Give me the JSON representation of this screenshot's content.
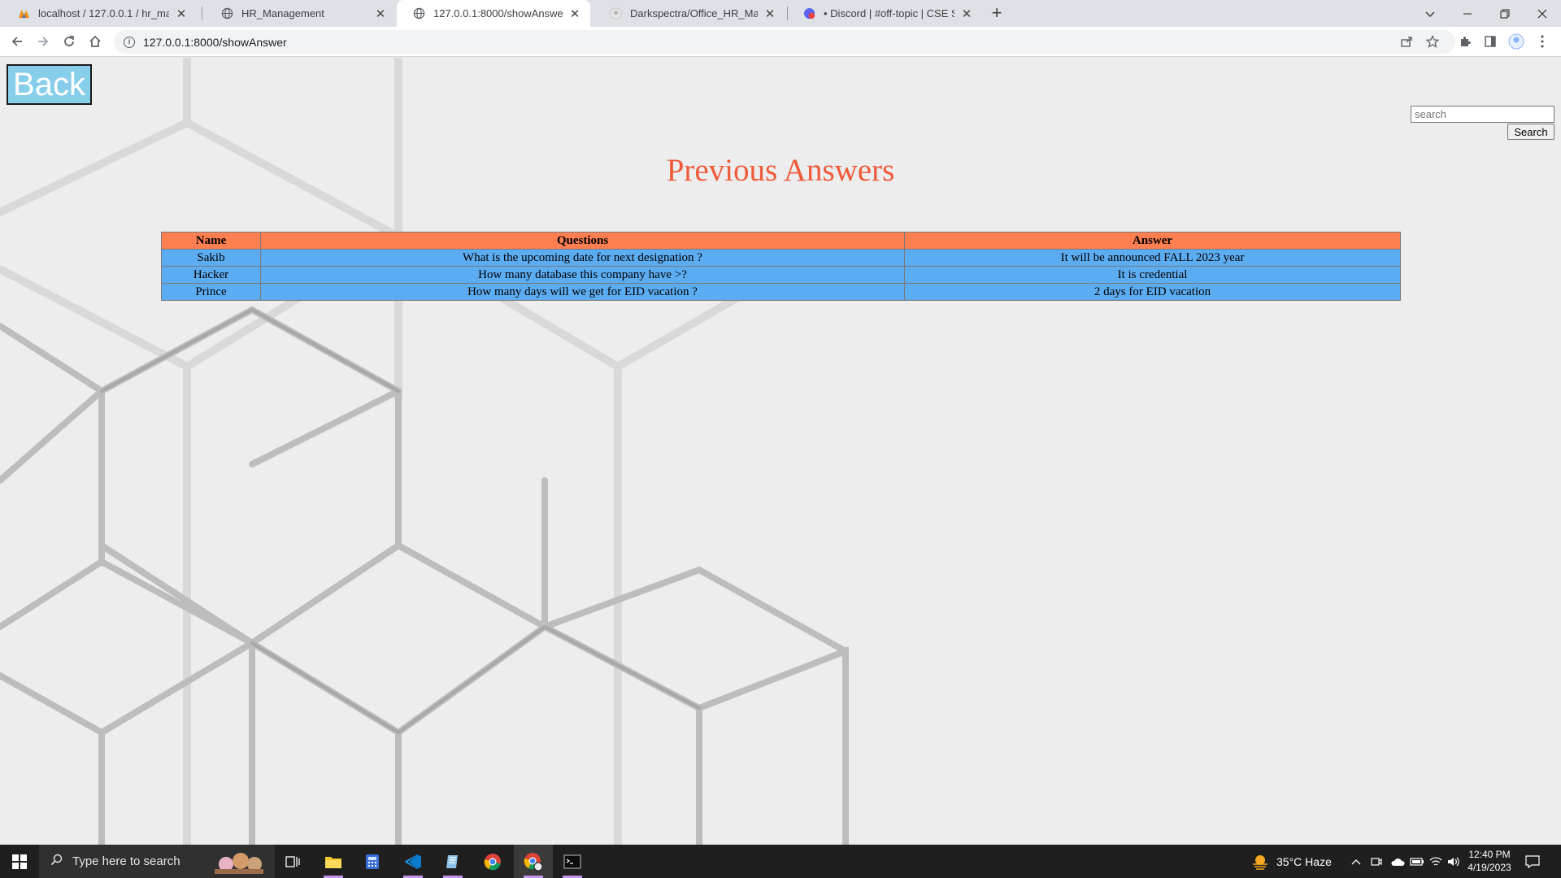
{
  "browser": {
    "tabs": [
      {
        "title": "localhost / 127.0.0.1 / hr_man / e",
        "icon": "phpmyadmin-icon",
        "active": false
      },
      {
        "title": "HR_Management",
        "icon": "globe-icon",
        "active": false
      },
      {
        "title": "127.0.0.1:8000/showAnswer",
        "icon": "globe-icon",
        "active": true
      },
      {
        "title": "Darkspectra/Office_HR_Managem",
        "icon": "github-icon",
        "active": false
      },
      {
        "title": "• Discord | #off-topic | CSE Stude",
        "icon": "discord-icon",
        "active": false
      }
    ],
    "new_tab": "+",
    "address": "127.0.0.1:8000/showAnswer"
  },
  "page": {
    "back_label": "Back",
    "search_placeholder": "search",
    "search_button": "Search",
    "title": "Previous Answers",
    "table": {
      "headers": [
        "Name",
        "Questions",
        "Answer"
      ],
      "rows": [
        {
          "name": "Sakib",
          "question": "What is the upcoming date for next designation ?",
          "answer": "It will be announced FALL 2023 year"
        },
        {
          "name": "Hacker",
          "question": "How many database this company have >?",
          "answer": "It is credential"
        },
        {
          "name": "Prince",
          "question": "How many days will we get for EID vacation ?",
          "answer": "2 days for EID vacation"
        }
      ]
    }
  },
  "taskbar": {
    "search_placeholder": "Type here to search",
    "weather": "35°C  Haze",
    "time": "12:40 PM",
    "date": "4/19/2023"
  },
  "colors": {
    "title": "#ef5a3a",
    "header_row": "#ff7f50",
    "body_row": "#5cacf2",
    "back_button": "#87ceeb"
  }
}
